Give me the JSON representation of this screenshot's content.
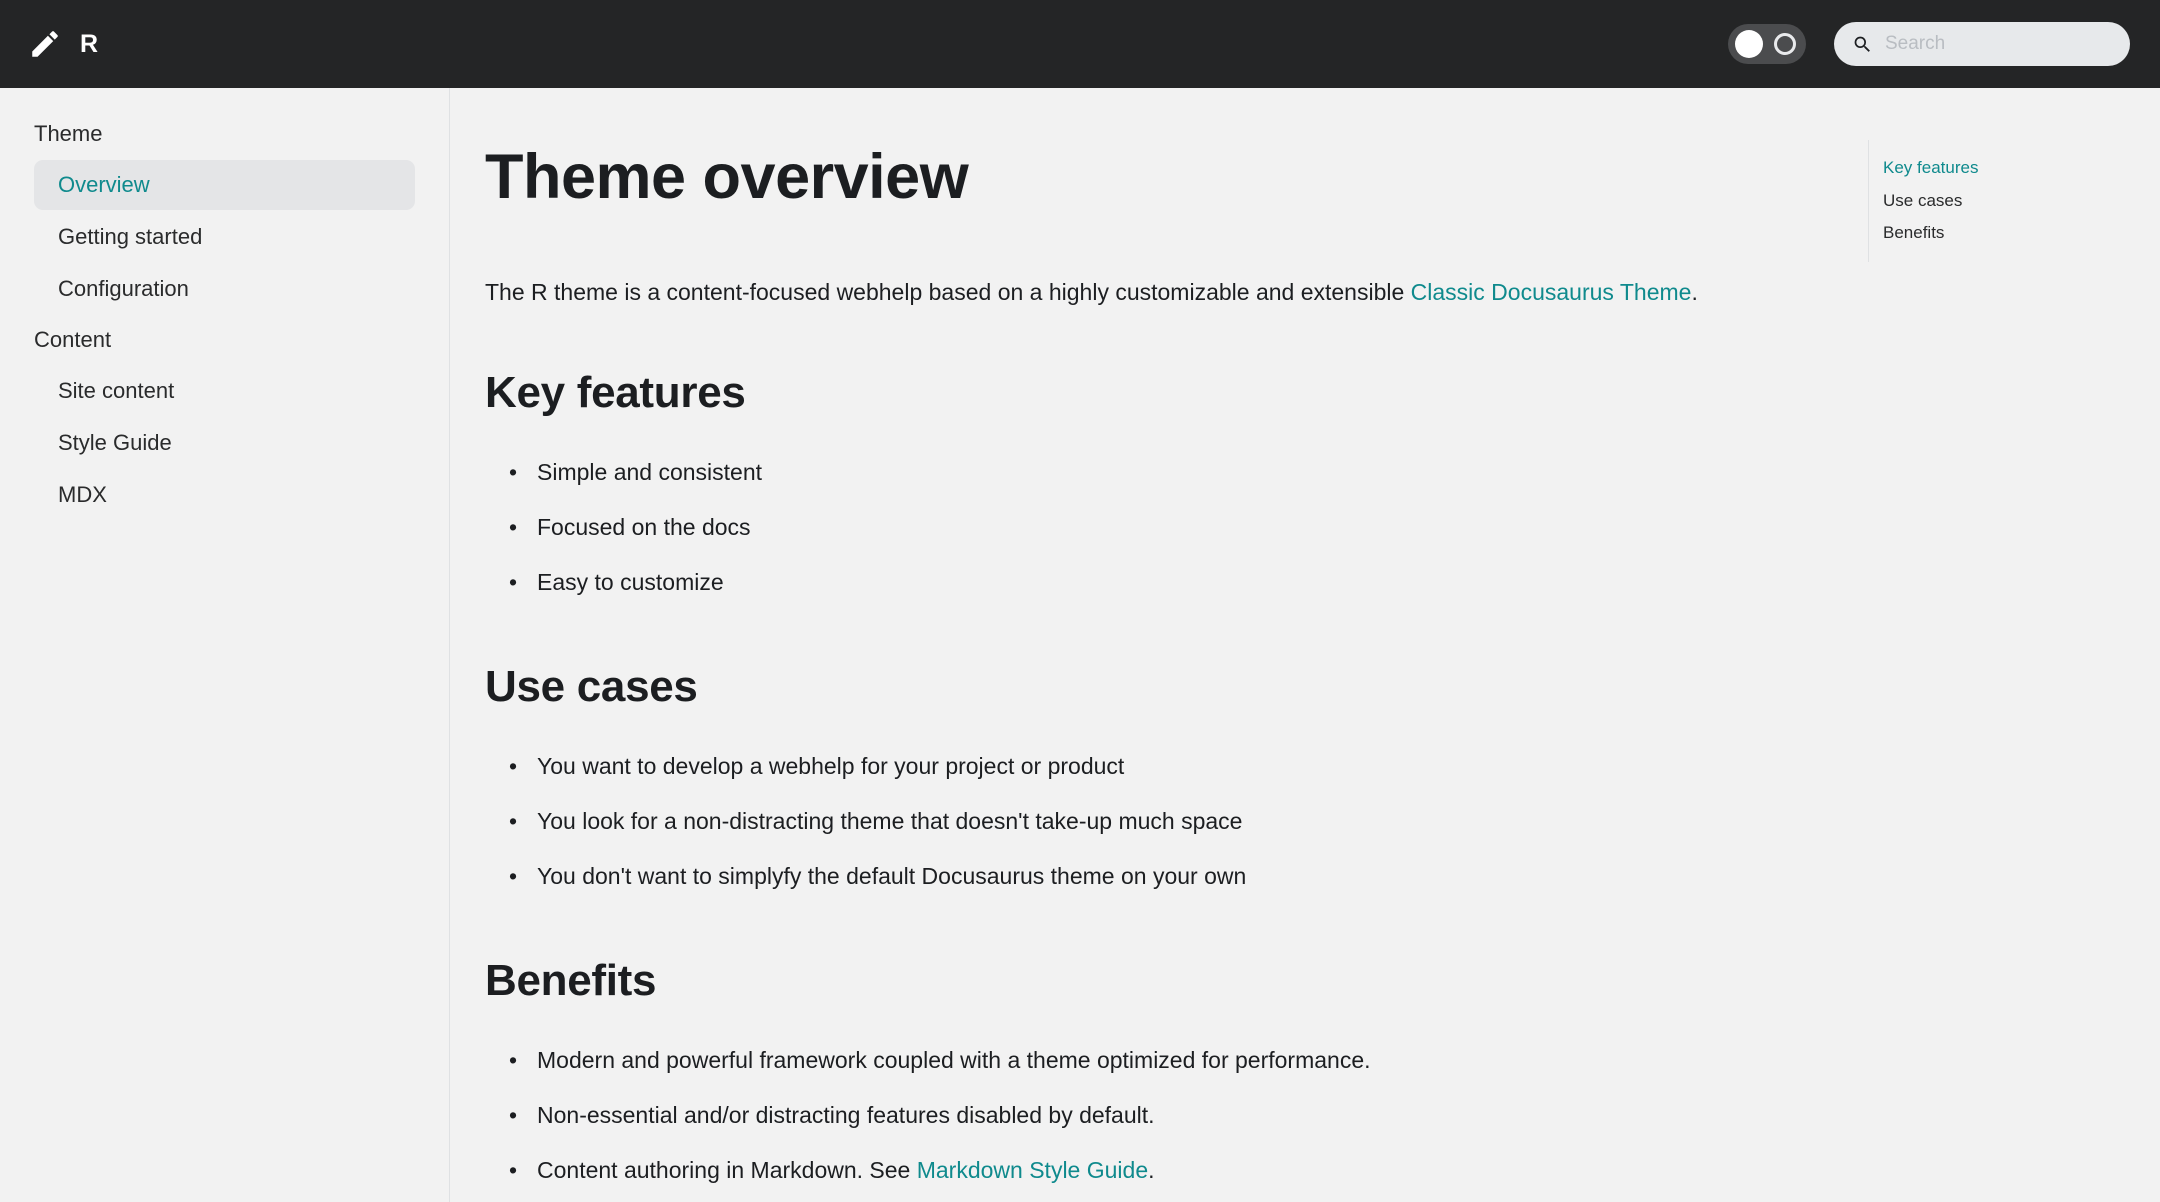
{
  "navbar": {
    "logo_icon": "pencil-icon",
    "title": "R",
    "theme_toggle": {
      "icon_on": "sun-circle-icon",
      "icon_off": "moon-circle-icon",
      "state": "light"
    },
    "search": {
      "icon": "search-icon",
      "placeholder": "Search",
      "value": ""
    }
  },
  "sidebar": {
    "groups": [
      {
        "label": "Theme",
        "items": [
          {
            "label": "Overview",
            "active": true
          },
          {
            "label": "Getting started",
            "active": false
          },
          {
            "label": "Configuration",
            "active": false
          }
        ]
      },
      {
        "label": "Content",
        "items": [
          {
            "label": "Site content",
            "active": false
          },
          {
            "label": "Style Guide",
            "active": false
          },
          {
            "label": "MDX",
            "active": false
          }
        ]
      }
    ]
  },
  "article": {
    "title": "Theme overview",
    "intro": {
      "before": "The R theme is a content-focused webhelp based on a highly customizable and extensible ",
      "link": "Classic Docusaurus Theme",
      "after": "."
    },
    "sections": [
      {
        "heading": "Key features",
        "items": [
          {
            "text": "Simple and consistent"
          },
          {
            "text": "Focused on the docs"
          },
          {
            "text": "Easy to customize"
          }
        ]
      },
      {
        "heading": "Use cases",
        "items": [
          {
            "text": "You want to develop a webhelp for your project or product"
          },
          {
            "text": "You look for a non-distracting theme that doesn't take-up much space"
          },
          {
            "text": "You don't want to simplyfy the default Docusaurus theme on your own"
          }
        ]
      },
      {
        "heading": "Benefits",
        "items": [
          {
            "text": "Modern and powerful framework coupled with a theme optimized for performance."
          },
          {
            "text": "Non-essential and/or distracting features disabled by default."
          },
          {
            "text": "Content authoring in Markdown. See ",
            "link": "Markdown Style Guide",
            "after": "."
          }
        ]
      }
    ]
  },
  "toc": {
    "items": [
      {
        "label": "Key features",
        "active": true
      },
      {
        "label": "Use cases",
        "active": false
      },
      {
        "label": "Benefits",
        "active": false
      }
    ]
  },
  "colors": {
    "accent": "#0f8a8d",
    "navbar_bg": "#242526",
    "page_bg": "#f2f2f2",
    "text": "#1c1e21",
    "sidebar_active_bg": "#e4e5e7",
    "search_bg": "#e7e9eb",
    "border": "#dfe1e3"
  }
}
